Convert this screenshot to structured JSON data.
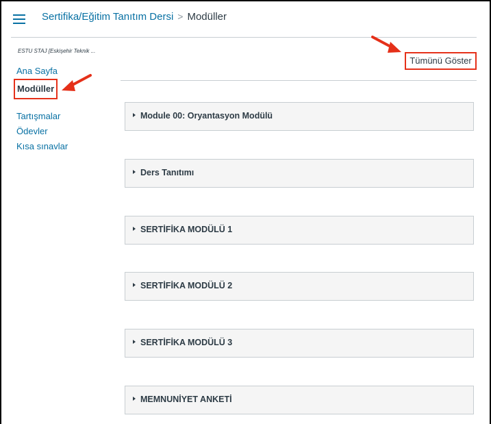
{
  "header": {
    "course_link": "Sertifika/Eğitim Tanıtım Dersi",
    "separator": ">",
    "current": "Modüller"
  },
  "sidebar": {
    "course_name": "ESTU STAJ [Eskişehir Teknik ...",
    "items": [
      {
        "label": "Ana Sayfa"
      },
      {
        "label": "Modüller"
      },
      {
        "label": "Tartışmalar"
      },
      {
        "label": "Ödevler"
      },
      {
        "label": "Kısa sınavlar"
      }
    ]
  },
  "toolbar": {
    "show_all_label": "Tümünü Göster"
  },
  "modules": [
    {
      "title": "Module 00: Oryantasyon Modülü"
    },
    {
      "title": "Ders Tanıtımı"
    },
    {
      "title": "SERTİFİKA MODÜLÜ 1"
    },
    {
      "title": "SERTİFİKA MODÜLÜ 2"
    },
    {
      "title": "SERTİFİKA MODÜLÜ 3"
    },
    {
      "title": "MEMNUNİYET ANKETİ"
    }
  ],
  "colors": {
    "link": "#0770a3",
    "highlight": "#e53019",
    "module_bg": "#f5f5f5"
  }
}
